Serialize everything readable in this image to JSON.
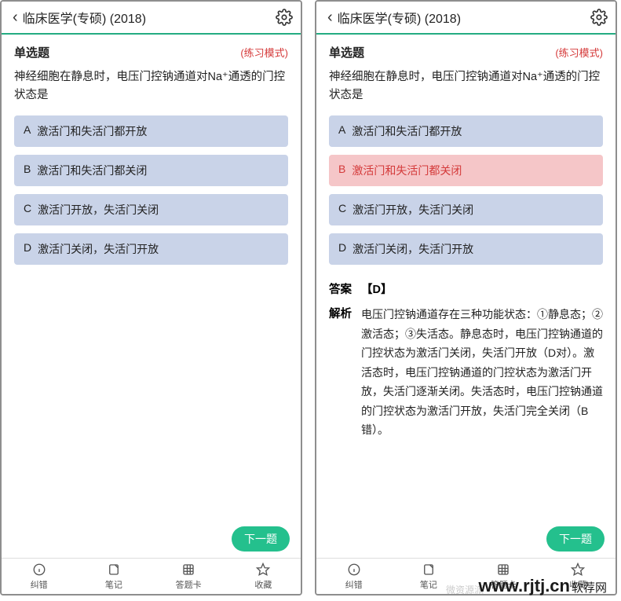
{
  "header": {
    "title": "临床医学(专硕) (2018)"
  },
  "qtype": "单选题",
  "mode": "(练习模式)",
  "question": "神经细胞在静息时，电压门控钠通道对Na⁺通透的门控状态是",
  "options": [
    {
      "letter": "A",
      "text": "激活门和失活门都开放"
    },
    {
      "letter": "B",
      "text": "激活门和失活门都关闭"
    },
    {
      "letter": "C",
      "text": "激活门开放，失活门关闭"
    },
    {
      "letter": "D",
      "text": "激活门关闭，失活门开放"
    }
  ],
  "answer": {
    "label": "答案",
    "value": "【D】",
    "expl_label": "解析",
    "explanation": "电压门控钠通道存在三种功能状态：①静息态；②激活态；③失活态。静息态时，电压门控钠通道的门控状态为激活门关闭，失活门开放（D对）。激活态时，电压门控钠通道的门控状态为激活门开放，失活门逐渐关闭。失活态时，电压门控钠通道的门控状态为激活门开放，失活门完全关闭（B错）。"
  },
  "next_label": "下一题",
  "tabs": [
    {
      "label": "纠错"
    },
    {
      "label": "笔记"
    },
    {
      "label": "答题卡"
    },
    {
      "label": "收藏"
    }
  ],
  "watermark": "www.rjtj.cn",
  "watermark_sub": "软荐网",
  "ghost": "微资源派"
}
